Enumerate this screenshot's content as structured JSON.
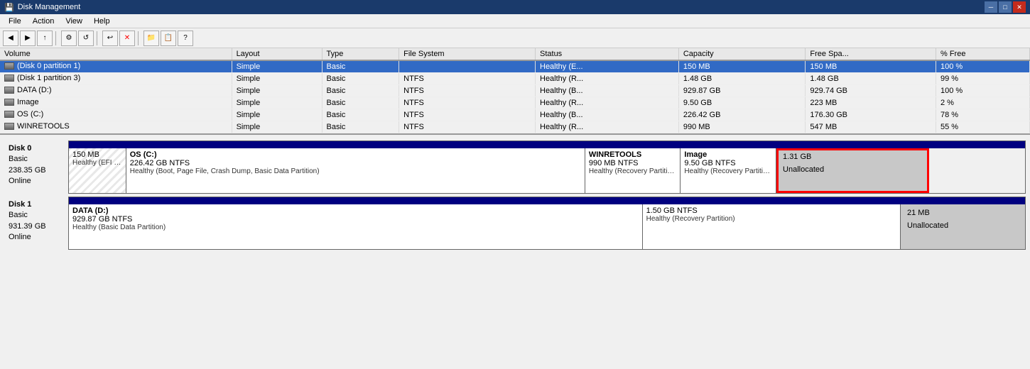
{
  "window": {
    "title": "Disk Management",
    "icon": "disk-icon"
  },
  "menu": {
    "items": [
      "File",
      "Action",
      "View",
      "Help"
    ]
  },
  "volumes": {
    "columns": [
      "Volume",
      "Layout",
      "Type",
      "File System",
      "Status",
      "Capacity",
      "Free Spa...",
      "% Free"
    ],
    "rows": [
      {
        "name": "(Disk 0 partition 1)",
        "layout": "Simple",
        "type": "Basic",
        "fs": "",
        "status": "Healthy (E...",
        "capacity": "150 MB",
        "free": "150 MB",
        "pct": "100 %",
        "selected": true
      },
      {
        "name": "(Disk 1 partition 3)",
        "layout": "Simple",
        "type": "Basic",
        "fs": "NTFS",
        "status": "Healthy (R...",
        "capacity": "1.48 GB",
        "free": "1.48 GB",
        "pct": "99 %",
        "selected": false
      },
      {
        "name": "DATA (D:)",
        "layout": "Simple",
        "type": "Basic",
        "fs": "NTFS",
        "status": "Healthy (B...",
        "capacity": "929.87 GB",
        "free": "929.74 GB",
        "pct": "100 %",
        "selected": false
      },
      {
        "name": "Image",
        "layout": "Simple",
        "type": "Basic",
        "fs": "NTFS",
        "status": "Healthy (R...",
        "capacity": "9.50 GB",
        "free": "223 MB",
        "pct": "2 %",
        "selected": false
      },
      {
        "name": "OS (C:)",
        "layout": "Simple",
        "type": "Basic",
        "fs": "NTFS",
        "status": "Healthy (B...",
        "capacity": "226.42 GB",
        "free": "176.30 GB",
        "pct": "78 %",
        "selected": false
      },
      {
        "name": "WINRETOOLS",
        "layout": "Simple",
        "type": "Basic",
        "fs": "NTFS",
        "status": "Healthy (R...",
        "capacity": "990 MB",
        "free": "547 MB",
        "pct": "55 %",
        "selected": false
      }
    ]
  },
  "disk0": {
    "name": "Disk 0",
    "type": "Basic",
    "size": "238.35 GB",
    "status": "Online",
    "partitions": [
      {
        "id": "efi",
        "label": "",
        "size": "150 MB",
        "fs": "",
        "status": "Healthy (EFI System Partition)",
        "widthPct": 6,
        "striped": true
      },
      {
        "id": "os",
        "label": "OS (C:)",
        "size": "226.42 GB NTFS",
        "status": "Healthy (Boot, Page File, Crash Dump, Basic Data Partition)",
        "widthPct": 48,
        "striped": false
      },
      {
        "id": "winretools",
        "label": "WINRETOOLS",
        "size": "990 MB NTFS",
        "status": "Healthy (Recovery Partition)",
        "widthPct": 10,
        "striped": false
      },
      {
        "id": "image",
        "label": "Image",
        "size": "9.50 GB NTFS",
        "status": "Healthy (Recovery Partition)",
        "widthPct": 10,
        "striped": false
      },
      {
        "id": "unalloc0",
        "label": "1.31 GB",
        "sublabel": "Unallocated",
        "widthPct": 16,
        "unallocated": true,
        "highlighted": true
      }
    ]
  },
  "disk1": {
    "name": "Disk 1",
    "type": "Basic",
    "size": "931.39 GB",
    "status": "Online",
    "partitions": [
      {
        "id": "data",
        "label": "DATA (D:)",
        "size": "929.87 GB NTFS",
        "status": "Healthy (Basic Data Partition)",
        "widthPct": 60,
        "striped": false
      },
      {
        "id": "recovery1",
        "label": "",
        "size": "1.50 GB NTFS",
        "status": "Healthy (Recovery Partition)",
        "widthPct": 27,
        "striped": false
      },
      {
        "id": "unalloc1",
        "label": "21 MB",
        "sublabel": "Unallocated",
        "widthPct": 13,
        "unallocated": true
      }
    ]
  }
}
